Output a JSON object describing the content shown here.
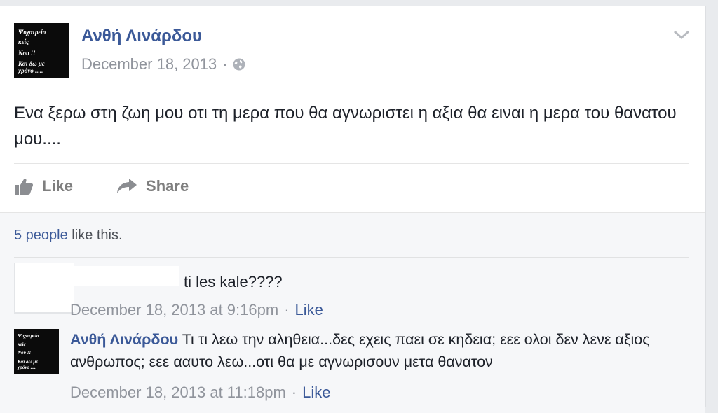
{
  "post": {
    "author": "Ανθή Λινάρδου",
    "date": "December 18, 2013",
    "separator": "·",
    "privacy_icon": "globe-icon",
    "menu_icon": "chevron-down-icon",
    "text": "Ενα ξερω στη ζωη μου οτι τη μερα που θα αγνωριστει η αξια θα ειναι η μερα του θανατου μου....",
    "avatar_text": [
      "Ψυχοτρείο",
      "κείς",
      "Νου !!",
      "Και δω με",
      "χρόνο ....."
    ]
  },
  "actions": {
    "like_label": "Like",
    "share_label": "Share"
  },
  "likes": {
    "count_text": "5 people",
    "suffix_text": " like this."
  },
  "comments": [
    {
      "author": "",
      "text": "ti les kale????",
      "time": "December 18, 2013 at 9:16pm",
      "like_label": "Like"
    },
    {
      "author": "Ανθή Λινάρδου",
      "text": "Τι τι λεω την αληθεια...δες εχεις παει σε κηδεια; εεε ολοι δεν λενε αξιος ανθρωπος; εεε ααυτο λεω...οτι θα με αγνωρισουν μετα θανατον",
      "time": "December 18, 2013 at 11:18pm",
      "like_label": "Like"
    }
  ],
  "colors": {
    "link": "#3b5998",
    "meta": "#90949c",
    "text": "#1d2129",
    "action": "#7f7f7f",
    "background": "#e9ebee"
  }
}
